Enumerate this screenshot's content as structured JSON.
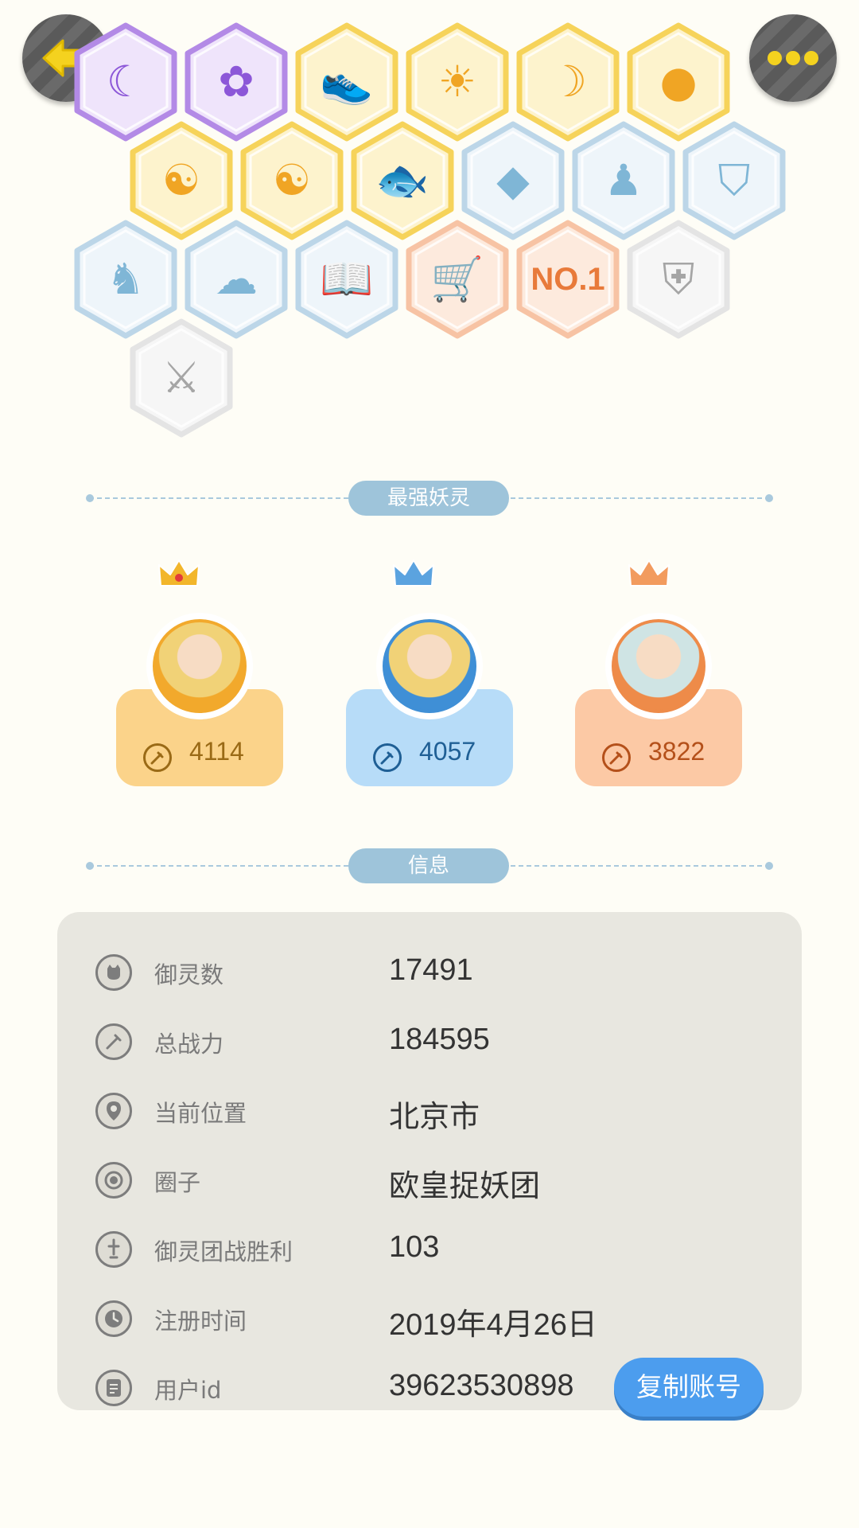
{
  "header": {
    "back_icon": "back-arrow-icon",
    "more_icon": "more-dots-icon"
  },
  "badges": [
    {
      "name": "purple-moon-cat",
      "tier": "purple",
      "icon": "moon-cat-icon"
    },
    {
      "name": "purple-flower-cat",
      "tier": "purple",
      "icon": "flower-cat-icon"
    },
    {
      "name": "gold-shoe",
      "tier": "gold",
      "icon": "shoe-icon"
    },
    {
      "name": "gold-sun-trophy",
      "tier": "gold",
      "icon": "sun-trophy-icon"
    },
    {
      "name": "gold-moon-sun",
      "tier": "gold",
      "icon": "moon-sun-icon"
    },
    {
      "name": "gold-orb",
      "tier": "gold",
      "icon": "orb-icon"
    },
    {
      "name": "gold-yin-yang-comet",
      "tier": "gold",
      "icon": "yin-yang-comet-icon"
    },
    {
      "name": "gold-yin-yang-scroll",
      "tier": "gold",
      "icon": "yin-yang-scroll-icon"
    },
    {
      "name": "gold-koi",
      "tier": "gold",
      "icon": "koi-fish-icon"
    },
    {
      "name": "blue-crystal",
      "tier": "blue",
      "icon": "crystal-icon"
    },
    {
      "name": "blue-spirit",
      "tier": "blue",
      "icon": "spirit-icon"
    },
    {
      "name": "blue-shield",
      "tier": "blue",
      "icon": "shield-icon"
    },
    {
      "name": "blue-demon",
      "tier": "blue",
      "icon": "demon-icon"
    },
    {
      "name": "blue-ghost-cat",
      "tier": "blue",
      "icon": "ghost-cat-icon"
    },
    {
      "name": "blue-book-fox",
      "tier": "blue",
      "icon": "book-fox-icon"
    },
    {
      "name": "orange-cart-cat",
      "tier": "orange",
      "icon": "cart-cat-icon"
    },
    {
      "name": "orange-no1",
      "tier": "orange",
      "icon": "no1-icon",
      "text": "NO.1"
    },
    {
      "name": "grey-belt",
      "tier": "grey",
      "icon": "belt-icon"
    },
    {
      "name": "grey-swords",
      "tier": "grey",
      "icon": "crossed-swords-icon"
    }
  ],
  "tier_colors": {
    "purple": {
      "border": "#b38ae6",
      "fill": "#efe4fb"
    },
    "gold": {
      "border": "#f6d35a",
      "fill": "#fdf3cd"
    },
    "blue": {
      "border": "#bcd6e8",
      "fill": "#eef5fa"
    },
    "orange": {
      "border": "#f7c3a4",
      "fill": "#fdeadd"
    },
    "grey": {
      "border": "#e4e4e4",
      "fill": "#f6f6f6"
    }
  },
  "strongest_section": {
    "title": "最强妖灵"
  },
  "strongest": [
    {
      "rank": 1,
      "power": "4114",
      "color": "#fbd38a",
      "text_color": "#9a6a16",
      "crown_color": "#f2b62b",
      "avatar_ring": "#f2a92c"
    },
    {
      "rank": 2,
      "power": "4057",
      "color": "#b7dcf8",
      "text_color": "#1f5f95",
      "crown_color": "#5ba3df",
      "avatar_ring": "#3f8fd6"
    },
    {
      "rank": 3,
      "power": "3822",
      "color": "#fcc9a5",
      "text_color": "#b4501a",
      "crown_color": "#f29b5e",
      "avatar_ring": "#ee8b49"
    }
  ],
  "info_section": {
    "title": "信息"
  },
  "info": [
    {
      "icon": "spirit-count-icon",
      "label": "御灵数",
      "value": "17491"
    },
    {
      "icon": "combat-power-icon",
      "label": "总战力",
      "value": "184595"
    },
    {
      "icon": "location-pin-icon",
      "label": "当前位置",
      "value": "北京市"
    },
    {
      "icon": "circle-target-icon",
      "label": "圈子",
      "value": "欧皇捉妖团"
    },
    {
      "icon": "team-battle-icon",
      "label": "御灵团战胜利",
      "value": "103"
    },
    {
      "icon": "clock-icon",
      "label": "注册时间",
      "value": "2019年4月26日"
    },
    {
      "icon": "user-id-icon",
      "label": "用户id",
      "value": "39623530898"
    }
  ],
  "copy_button": {
    "label": "复制账号",
    "color": "#4c9dee"
  }
}
